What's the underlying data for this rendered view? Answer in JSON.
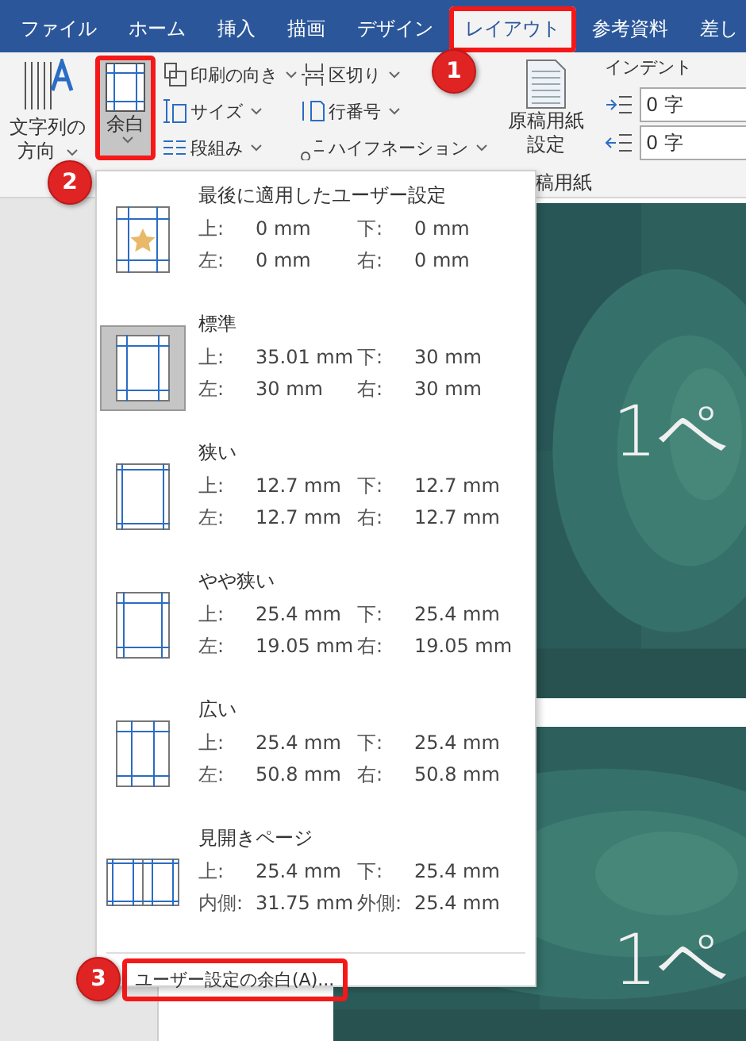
{
  "tabs": [
    {
      "label": "ファイル",
      "selected": false
    },
    {
      "label": "ホーム",
      "selected": false
    },
    {
      "label": "挿入",
      "selected": false
    },
    {
      "label": "描画",
      "selected": false
    },
    {
      "label": "デザイン",
      "selected": false
    },
    {
      "label": "レイアウト",
      "selected": true,
      "highlighted": true
    },
    {
      "label": "参考資料",
      "selected": false
    },
    {
      "label": "差し",
      "selected": false
    }
  ],
  "ribbon": {
    "text_direction": {
      "label": "文字列の",
      "label_2": "方向"
    },
    "margins": {
      "label": "余白",
      "selected": true,
      "highlighted": true
    },
    "column_1": [
      {
        "label": "印刷の向き",
        "kind": "orientation"
      },
      {
        "label": "サイズ",
        "kind": "size"
      },
      {
        "label": "段組み",
        "kind": "columns"
      }
    ],
    "column_2": [
      {
        "label": "区切り",
        "kind": "breaks"
      },
      {
        "label": "行番号",
        "kind": "numbers"
      },
      {
        "label": "ハイフネーション",
        "kind": "hyphen"
      }
    ],
    "manuscript": {
      "label": "原稿用紙",
      "label_2": "設定",
      "group_label": "稿用紙"
    },
    "indent": {
      "title": "インデント",
      "fields": [
        {
          "value": "0 字",
          "kind": "left"
        },
        {
          "value": "0 字",
          "kind": "right"
        }
      ]
    }
  },
  "document": {
    "pages": [
      {
        "text": "1ペ"
      },
      {
        "text": "1ペ"
      }
    ]
  },
  "margin_menu": {
    "items": [
      {
        "title": "最後に適用したユーザー設定",
        "kind": "custom",
        "selected": false,
        "cells": [
          [
            "上:",
            "0 mm",
            "下:",
            "0 mm"
          ],
          [
            "左:",
            "0 mm",
            "右:",
            "0 mm"
          ]
        ]
      },
      {
        "title": "標準",
        "kind": "normal",
        "selected": true,
        "cells": [
          [
            "上:",
            "35.01 mm",
            "下:",
            "30 mm"
          ],
          [
            "左:",
            "30 mm",
            "右:",
            "30 mm"
          ]
        ]
      },
      {
        "title": "狭い",
        "kind": "narrow",
        "selected": false,
        "cells": [
          [
            "上:",
            "12.7 mm",
            "下:",
            "12.7 mm"
          ],
          [
            "左:",
            "12.7 mm",
            "右:",
            "12.7 mm"
          ]
        ]
      },
      {
        "title": "やや狭い",
        "kind": "moderate",
        "selected": false,
        "cells": [
          [
            "上:",
            "25.4 mm",
            "下:",
            "25.4 mm"
          ],
          [
            "左:",
            "19.05 mm",
            "右:",
            "19.05 mm"
          ]
        ]
      },
      {
        "title": "広い",
        "kind": "wide",
        "selected": false,
        "cells": [
          [
            "上:",
            "25.4 mm",
            "下:",
            "25.4 mm"
          ],
          [
            "左:",
            "50.8 mm",
            "右:",
            "50.8 mm"
          ]
        ]
      },
      {
        "title": "見開きページ",
        "kind": "mirrored",
        "selected": false,
        "cells": [
          [
            "上:",
            "25.4 mm",
            "下:",
            "25.4 mm"
          ],
          [
            "内側:",
            "31.75 mm",
            "外側:",
            "25.4 mm"
          ]
        ]
      }
    ],
    "footer": "ユーザー設定の余白(A)...",
    "footer_highlighted": true
  },
  "callouts": [
    "1",
    "2",
    "3"
  ]
}
